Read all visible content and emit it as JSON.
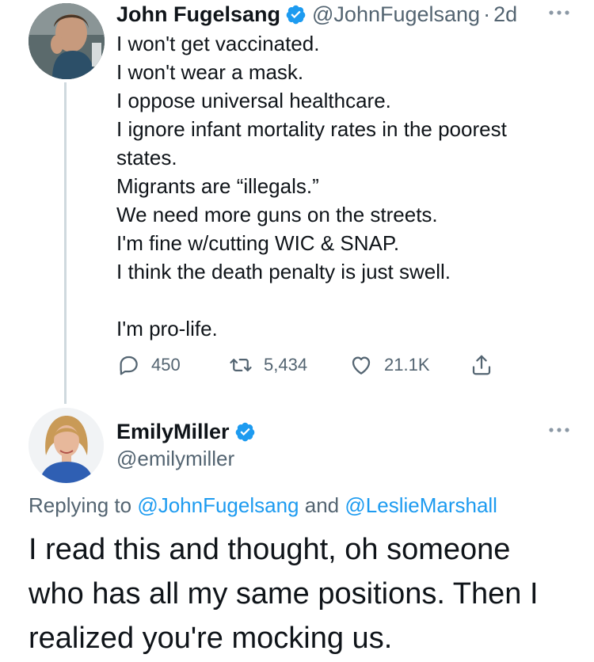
{
  "tweet": {
    "author": {
      "display_name": "John Fugelsang",
      "handle": "@JohnFugelsang",
      "verified": true
    },
    "separator": "·",
    "time": "2d",
    "lines": [
      "I won't get vaccinated.",
      "I won't wear a mask.",
      "I oppose universal healthcare.",
      "I ignore infant mortality rates in the poorest",
      "states.",
      "Migrants are “illegals.”",
      "We need more guns on the streets.",
      "I'm fine w/cutting WIC & SNAP.",
      "I think the death penalty is just swell.",
      "",
      "I'm pro-life."
    ],
    "actions": {
      "replies": "450",
      "retweets": "5,434",
      "likes": "21.1K"
    }
  },
  "reply": {
    "author": {
      "display_name": "EmilyMiller",
      "handle": "@emilymiller",
      "verified": true
    },
    "replying_prefix": "Replying to",
    "replying_to": [
      "@JohnFugelsang",
      "@LeslieMarshall"
    ],
    "replying_joiner": "and",
    "lines": [
      "I read this and thought, oh someone",
      "who has all my same positions. Then I",
      "realized you're mocking us."
    ]
  },
  "colors": {
    "text": "#0f1419",
    "secondary": "#536471",
    "accent": "#1d9bf0",
    "thread_line": "#cfd9de"
  },
  "icons": [
    "verified-badge-icon",
    "more-options-icon",
    "reply-icon",
    "retweet-icon",
    "like-icon",
    "share-icon"
  ]
}
